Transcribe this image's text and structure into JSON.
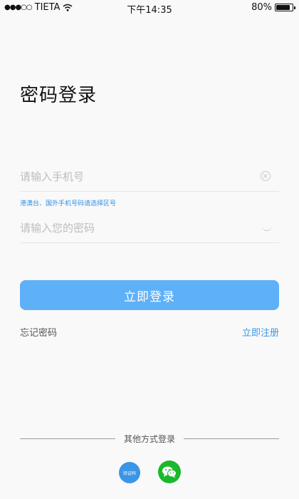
{
  "status_bar": {
    "carrier": "TIETA",
    "time": "下午14:35",
    "battery": "80%",
    "battery_level": 0.8
  },
  "page": {
    "title": "密码登录"
  },
  "form": {
    "phone_placeholder": "请输入手机号",
    "region_hint": "港澳台、国外手机号码请选择区号",
    "password_placeholder": "请输入您的密码",
    "login_button": "立即登录"
  },
  "links": {
    "forgot_password": "忘记密码",
    "register": "立即注册"
  },
  "alt_login": {
    "label": "其他方式登录",
    "sms_label": "验证码"
  },
  "colors": {
    "accent": "#5fb1f7",
    "link": "#3a95e6",
    "wechat": "#1bb82c"
  }
}
